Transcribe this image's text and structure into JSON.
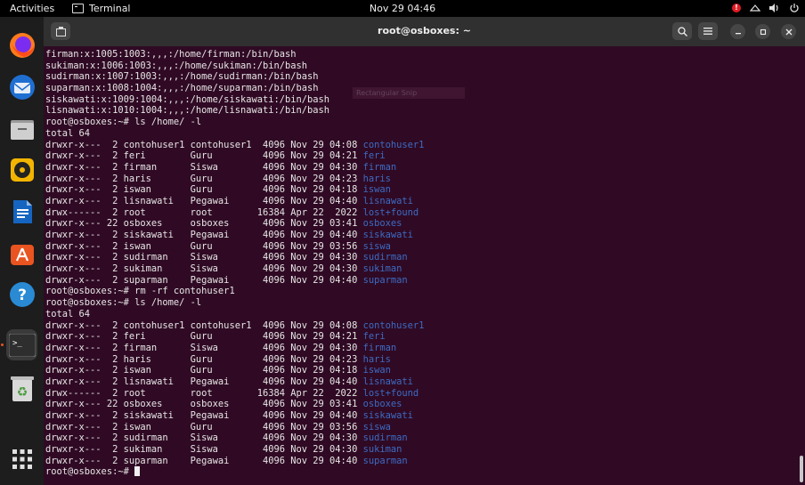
{
  "topbar": {
    "activities": "Activities",
    "app_name": "Terminal",
    "clock": "Nov 29  04:46",
    "notification_badge": "!"
  },
  "dock": {
    "items": [
      {
        "name": "firefox-icon"
      },
      {
        "name": "thunderbird-icon"
      },
      {
        "name": "files-icon"
      },
      {
        "name": "rhythmbox-icon"
      },
      {
        "name": "writer-icon"
      },
      {
        "name": "software-icon"
      },
      {
        "name": "help-icon"
      },
      {
        "name": "terminal-icon"
      },
      {
        "name": "trash-icon"
      },
      {
        "name": "app-grid-icon"
      }
    ]
  },
  "window": {
    "title": "root@osboxes: ~",
    "ghost_text": "Rectangular Snip"
  },
  "terminal": {
    "lines": [
      {
        "text": "firman:x:1005:1003:,,,:/home/firman:/bin/bash"
      },
      {
        "text": "sukiman:x:1006:1003:,,,:/home/sukiman:/bin/bash"
      },
      {
        "text": "sudirman:x:1007:1003:,,,:/home/sudirman:/bin/bash"
      },
      {
        "text": "suparman:x:1008:1004:,,,:/home/suparman:/bin/bash"
      },
      {
        "text": "siskawati:x:1009:1004:,,,:/home/siskawati:/bin/bash"
      },
      {
        "text": "lisnawati:x:1010:1004:,,,:/home/lisnawati:/bin/bash"
      },
      {
        "text": "root@osboxes:~# ls /home/ -l"
      },
      {
        "text": "total 64"
      },
      {
        "text": "drwxr-x---  2 contohuser1 contohuser1  4096 Nov 29 04:08 ",
        "dir": "contohuser1"
      },
      {
        "text": "drwxr-x---  2 feri        Guru         4096 Nov 29 04:21 ",
        "dir": "feri"
      },
      {
        "text": "drwxr-x---  2 firman      Siswa        4096 Nov 29 04:30 ",
        "dir": "firman"
      },
      {
        "text": "drwxr-x---  2 haris       Guru         4096 Nov 29 04:23 ",
        "dir": "haris"
      },
      {
        "text": "drwxr-x---  2 iswan       Guru         4096 Nov 29 04:18 ",
        "dir": "iswan"
      },
      {
        "text": "drwxr-x---  2 lisnawati   Pegawai      4096 Nov 29 04:40 ",
        "dir": "lisnawati"
      },
      {
        "text": "drwx------  2 root        root        16384 Apr 22  2022 ",
        "dir": "lost+found"
      },
      {
        "text": "drwxr-x--- 22 osboxes     osboxes      4096 Nov 29 03:41 ",
        "dir": "osboxes"
      },
      {
        "text": "drwxr-x---  2 siskawati   Pegawai      4096 Nov 29 04:40 ",
        "dir": "siskawati"
      },
      {
        "text": "drwxr-x---  2 iswan       Guru         4096 Nov 29 03:56 ",
        "dir": "siswa"
      },
      {
        "text": "drwxr-x---  2 sudirman    Siswa        4096 Nov 29 04:30 ",
        "dir": "sudirman"
      },
      {
        "text": "drwxr-x---  2 sukiman     Siswa        4096 Nov 29 04:30 ",
        "dir": "sukiman"
      },
      {
        "text": "drwxr-x---  2 suparman    Pegawai      4096 Nov 29 04:40 ",
        "dir": "suparman"
      },
      {
        "text": "root@osboxes:~# rm -rf contohuser1"
      },
      {
        "text": "root@osboxes:~# ls /home/ -l"
      },
      {
        "text": "total 64"
      },
      {
        "text": "drwxr-x---  2 contohuser1 contohuser1  4096 Nov 29 04:08 ",
        "dir": "contohuser1"
      },
      {
        "text": "drwxr-x---  2 feri        Guru         4096 Nov 29 04:21 ",
        "dir": "feri"
      },
      {
        "text": "drwxr-x---  2 firman      Siswa        4096 Nov 29 04:30 ",
        "dir": "firman"
      },
      {
        "text": "drwxr-x---  2 haris       Guru         4096 Nov 29 04:23 ",
        "dir": "haris"
      },
      {
        "text": "drwxr-x---  2 iswan       Guru         4096 Nov 29 04:18 ",
        "dir": "iswan"
      },
      {
        "text": "drwxr-x---  2 lisnawati   Pegawai      4096 Nov 29 04:40 ",
        "dir": "lisnawati"
      },
      {
        "text": "drwx------  2 root        root        16384 Apr 22  2022 ",
        "dir": "lost+found"
      },
      {
        "text": "drwxr-x--- 22 osboxes     osboxes      4096 Nov 29 03:41 ",
        "dir": "osboxes"
      },
      {
        "text": "drwxr-x---  2 siskawati   Pegawai      4096 Nov 29 04:40 ",
        "dir": "siskawati"
      },
      {
        "text": "drwxr-x---  2 iswan       Guru         4096 Nov 29 03:56 ",
        "dir": "siswa"
      },
      {
        "text": "drwxr-x---  2 sudirman    Siswa        4096 Nov 29 04:30 ",
        "dir": "sudirman"
      },
      {
        "text": "drwxr-x---  2 sukiman     Siswa        4096 Nov 29 04:30 ",
        "dir": "sukiman"
      },
      {
        "text": "drwxr-x---  2 suparman    Pegawai      4096 Nov 29 04:40 ",
        "dir": "suparman"
      }
    ],
    "prompt": "root@osboxes:~# "
  }
}
